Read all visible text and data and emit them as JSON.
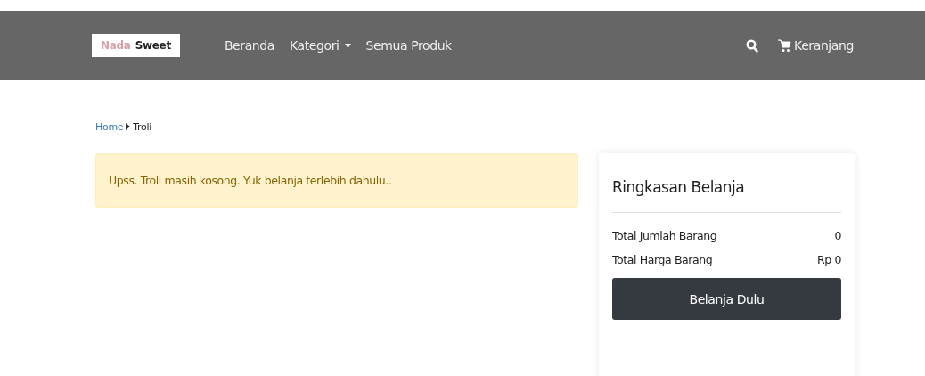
{
  "navbar": {
    "logo": {
      "part_1": "Nada",
      "part_2": "Sweet"
    },
    "links": [
      {
        "label": "Beranda",
        "kind": "link"
      },
      {
        "label": "Kategori",
        "kind": "dropdown"
      },
      {
        "label": "Semua Produk",
        "kind": "link"
      }
    ],
    "cart": {
      "label": "Keranjang"
    }
  },
  "breadcrumb": [
    {
      "label": "Home",
      "kind": "link"
    },
    {
      "label": "Troli",
      "kind": "current"
    }
  ],
  "alert": {
    "message": "Upss. Troli masih kosong. Yuk belanja terlebih dahulu.."
  },
  "summary": {
    "title": "Ringkasan Belanja",
    "rows": [
      {
        "label": "Total Jumlah Barang",
        "value": "0"
      },
      {
        "label": "Total Harga Barang",
        "value": "Rp 0"
      }
    ],
    "button": "Belanja Dulu"
  }
}
